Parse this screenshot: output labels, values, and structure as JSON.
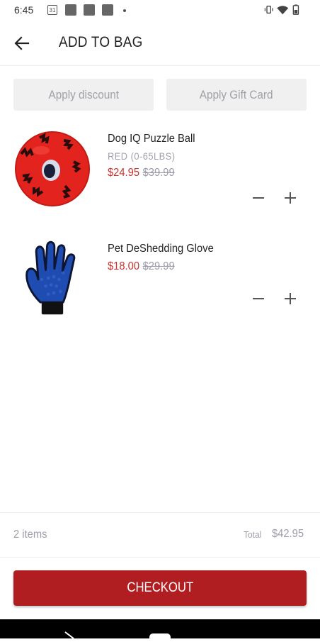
{
  "status_bar": {
    "time": "6:45",
    "calendar_day": "31"
  },
  "header": {
    "title": "ADD TO BAG"
  },
  "actions": {
    "discount_label": "Apply discount",
    "gift_card_label": "Apply Gift Card"
  },
  "cart": {
    "items": [
      {
        "name": "Dog IQ Puzzle Ball",
        "variant": "RED (0-65LBS)",
        "price": "$24.95",
        "original_price": "$39.99",
        "image_icon": "red-puzzle-ball"
      },
      {
        "name": "Pet DeShedding Glove",
        "variant": "",
        "price": "$18.00",
        "original_price": "$29.99",
        "image_icon": "blue-grooming-glove"
      }
    ]
  },
  "summary": {
    "item_count": "2 items",
    "total_label": "Total",
    "total_value": "$42.95"
  },
  "checkout": {
    "label": "CHECKOUT"
  },
  "colors": {
    "accent": "#b11e22",
    "sale_price": "#c8322f",
    "muted": "#9d9dac",
    "button_bg": "#f0f0f0"
  }
}
